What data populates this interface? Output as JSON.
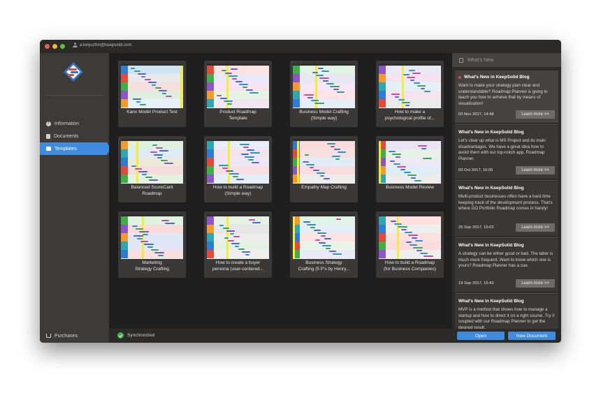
{
  "titlebar": {
    "account": "a.kelyuzhin@keepsolid.com"
  },
  "sidebar": {
    "items": [
      {
        "label": "Information",
        "icon": "info-icon"
      },
      {
        "label": "Documents",
        "icon": "document-icon"
      },
      {
        "label": "Templates",
        "icon": "folder-icon",
        "selected": true
      }
    ],
    "purchases_label": "Purchases"
  },
  "templates": [
    {
      "title": "Kano Model Product Test"
    },
    {
      "title": "Product Roadmap\nTemplate"
    },
    {
      "title": "Business Model Crafting\n(Simple way)"
    },
    {
      "title": "How to make a\npsychological profile of..."
    },
    {
      "title": "Balanced ScoreCard\nRoadmap"
    },
    {
      "title": "How to build a Roadmap\n(Simple way)"
    },
    {
      "title": "Empathy Map Crafting"
    },
    {
      "title": "Business Model Review"
    },
    {
      "title": "Marketing\nStrategy Crafting"
    },
    {
      "title": "How to create a buyer\npersona (user-centered..."
    },
    {
      "title": "Business Strategy\nCrafting (5 P's by Henry..."
    },
    {
      "title": "How to build a Roadmap\n(for Business Companies)"
    }
  ],
  "whats_new": {
    "header": "What's New",
    "posts": [
      {
        "title": "What's New in KeepSolid Blog",
        "unread": true,
        "body": "Want to make your strategy plan clear and understandable? Roadmap Planner is going to teach you how to achieve that by means of visualization!",
        "date": "03 Nov 2017, 14:48",
        "button": "Learn more >>"
      },
      {
        "title": "What's New in KeepSolid Blog",
        "unread": false,
        "body": "Let's clear up what is MS Project and its main disadvantages. We have a great idea how to avoid them with our top-notch app, Roadmap Planner.",
        "date": "03 Oct 2017, 16:05",
        "button": "Learn more >>"
      },
      {
        "title": "What's New in KeepSolid Blog",
        "unread": false,
        "body": "Multi-product businesses often have a hard time keeping track of the development process. That's where GO Portfolio Roadmap comes in handy!",
        "date": "25 Sep 2017, 15:02",
        "button": "Learn more >>"
      },
      {
        "title": "What's New in KeepSolid Blog",
        "unread": false,
        "body": "A strategy can be either good or bad. The latter is much more frequent. Want to know which one is yours? Roadmap Planner has a cue.",
        "date": "19 Sep 2017, 15:43",
        "button": "Learn more >>"
      },
      {
        "title": "What's New in KeepSolid Blog",
        "unread": false,
        "body": "MVP is a method that shows how to manage a startup and how to direct it on a right course. Try it coupled with our Roadmap Planner to get the desired result.",
        "date": "",
        "button": ""
      }
    ]
  },
  "status": {
    "sync_label": "Synchronized"
  },
  "actions": {
    "open_label": "Open",
    "new_document_label": "New Document"
  },
  "colors": {
    "accent": "#3e8be0",
    "sync_ok": "#47b04b",
    "unread_dot": "#e64545",
    "timeline_marker": "#f2ec3a"
  }
}
